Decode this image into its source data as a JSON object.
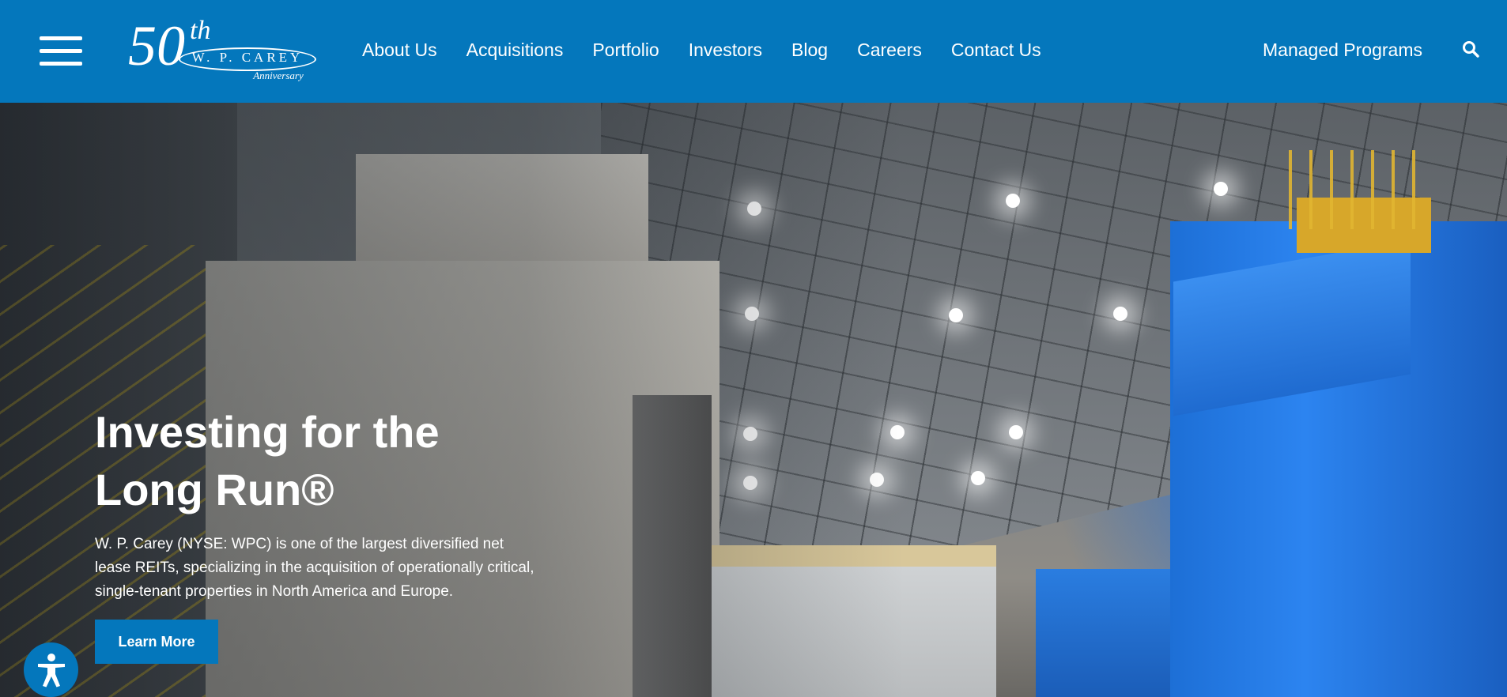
{
  "header": {
    "logo": {
      "number": "50",
      "suffix": "th",
      "brand": "W. P. CAREY",
      "tagline": "Anniversary"
    },
    "nav": [
      "About Us",
      "Acquisitions",
      "Portfolio",
      "Investors",
      "Blog",
      "Careers",
      "Contact Us"
    ],
    "managed_programs": "Managed Programs",
    "icons": {
      "menu": "hamburger-icon",
      "search": "search-icon"
    }
  },
  "hero": {
    "title_line1": "Investing for the",
    "title_line2": "Long Run®",
    "description": "W. P. Carey (NYSE: WPC) is one of the largest diversified net lease REITs, specializing in the acquisition of operationally critical, single-tenant properties in North America and Europe.",
    "cta": "Learn More"
  },
  "accessibility": {
    "icon": "accessibility-icon"
  },
  "colors": {
    "brand_blue": "#0477bc",
    "text_white": "#ffffff"
  }
}
